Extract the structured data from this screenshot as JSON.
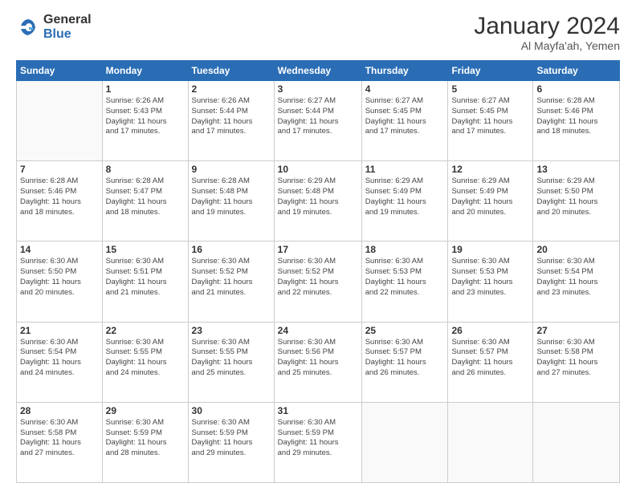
{
  "logo": {
    "general": "General",
    "blue": "Blue"
  },
  "header": {
    "month": "January 2024",
    "location": "Al Mayfa'ah, Yemen"
  },
  "weekdays": [
    "Sunday",
    "Monday",
    "Tuesday",
    "Wednesday",
    "Thursday",
    "Friday",
    "Saturday"
  ],
  "weeks": [
    [
      {
        "day": "",
        "info": ""
      },
      {
        "day": "1",
        "info": "Sunrise: 6:26 AM\nSunset: 5:43 PM\nDaylight: 11 hours\nand 17 minutes."
      },
      {
        "day": "2",
        "info": "Sunrise: 6:26 AM\nSunset: 5:44 PM\nDaylight: 11 hours\nand 17 minutes."
      },
      {
        "day": "3",
        "info": "Sunrise: 6:27 AM\nSunset: 5:44 PM\nDaylight: 11 hours\nand 17 minutes."
      },
      {
        "day": "4",
        "info": "Sunrise: 6:27 AM\nSunset: 5:45 PM\nDaylight: 11 hours\nand 17 minutes."
      },
      {
        "day": "5",
        "info": "Sunrise: 6:27 AM\nSunset: 5:45 PM\nDaylight: 11 hours\nand 17 minutes."
      },
      {
        "day": "6",
        "info": "Sunrise: 6:28 AM\nSunset: 5:46 PM\nDaylight: 11 hours\nand 18 minutes."
      }
    ],
    [
      {
        "day": "7",
        "info": "Sunrise: 6:28 AM\nSunset: 5:46 PM\nDaylight: 11 hours\nand 18 minutes."
      },
      {
        "day": "8",
        "info": "Sunrise: 6:28 AM\nSunset: 5:47 PM\nDaylight: 11 hours\nand 18 minutes."
      },
      {
        "day": "9",
        "info": "Sunrise: 6:28 AM\nSunset: 5:48 PM\nDaylight: 11 hours\nand 19 minutes."
      },
      {
        "day": "10",
        "info": "Sunrise: 6:29 AM\nSunset: 5:48 PM\nDaylight: 11 hours\nand 19 minutes."
      },
      {
        "day": "11",
        "info": "Sunrise: 6:29 AM\nSunset: 5:49 PM\nDaylight: 11 hours\nand 19 minutes."
      },
      {
        "day": "12",
        "info": "Sunrise: 6:29 AM\nSunset: 5:49 PM\nDaylight: 11 hours\nand 20 minutes."
      },
      {
        "day": "13",
        "info": "Sunrise: 6:29 AM\nSunset: 5:50 PM\nDaylight: 11 hours\nand 20 minutes."
      }
    ],
    [
      {
        "day": "14",
        "info": "Sunrise: 6:30 AM\nSunset: 5:50 PM\nDaylight: 11 hours\nand 20 minutes."
      },
      {
        "day": "15",
        "info": "Sunrise: 6:30 AM\nSunset: 5:51 PM\nDaylight: 11 hours\nand 21 minutes."
      },
      {
        "day": "16",
        "info": "Sunrise: 6:30 AM\nSunset: 5:52 PM\nDaylight: 11 hours\nand 21 minutes."
      },
      {
        "day": "17",
        "info": "Sunrise: 6:30 AM\nSunset: 5:52 PM\nDaylight: 11 hours\nand 22 minutes."
      },
      {
        "day": "18",
        "info": "Sunrise: 6:30 AM\nSunset: 5:53 PM\nDaylight: 11 hours\nand 22 minutes."
      },
      {
        "day": "19",
        "info": "Sunrise: 6:30 AM\nSunset: 5:53 PM\nDaylight: 11 hours\nand 23 minutes."
      },
      {
        "day": "20",
        "info": "Sunrise: 6:30 AM\nSunset: 5:54 PM\nDaylight: 11 hours\nand 23 minutes."
      }
    ],
    [
      {
        "day": "21",
        "info": "Sunrise: 6:30 AM\nSunset: 5:54 PM\nDaylight: 11 hours\nand 24 minutes."
      },
      {
        "day": "22",
        "info": "Sunrise: 6:30 AM\nSunset: 5:55 PM\nDaylight: 11 hours\nand 24 minutes."
      },
      {
        "day": "23",
        "info": "Sunrise: 6:30 AM\nSunset: 5:55 PM\nDaylight: 11 hours\nand 25 minutes."
      },
      {
        "day": "24",
        "info": "Sunrise: 6:30 AM\nSunset: 5:56 PM\nDaylight: 11 hours\nand 25 minutes."
      },
      {
        "day": "25",
        "info": "Sunrise: 6:30 AM\nSunset: 5:57 PM\nDaylight: 11 hours\nand 26 minutes."
      },
      {
        "day": "26",
        "info": "Sunrise: 6:30 AM\nSunset: 5:57 PM\nDaylight: 11 hours\nand 26 minutes."
      },
      {
        "day": "27",
        "info": "Sunrise: 6:30 AM\nSunset: 5:58 PM\nDaylight: 11 hours\nand 27 minutes."
      }
    ],
    [
      {
        "day": "28",
        "info": "Sunrise: 6:30 AM\nSunset: 5:58 PM\nDaylight: 11 hours\nand 27 minutes."
      },
      {
        "day": "29",
        "info": "Sunrise: 6:30 AM\nSunset: 5:59 PM\nDaylight: 11 hours\nand 28 minutes."
      },
      {
        "day": "30",
        "info": "Sunrise: 6:30 AM\nSunset: 5:59 PM\nDaylight: 11 hours\nand 29 minutes."
      },
      {
        "day": "31",
        "info": "Sunrise: 6:30 AM\nSunset: 5:59 PM\nDaylight: 11 hours\nand 29 minutes."
      },
      {
        "day": "",
        "info": ""
      },
      {
        "day": "",
        "info": ""
      },
      {
        "day": "",
        "info": ""
      }
    ]
  ]
}
